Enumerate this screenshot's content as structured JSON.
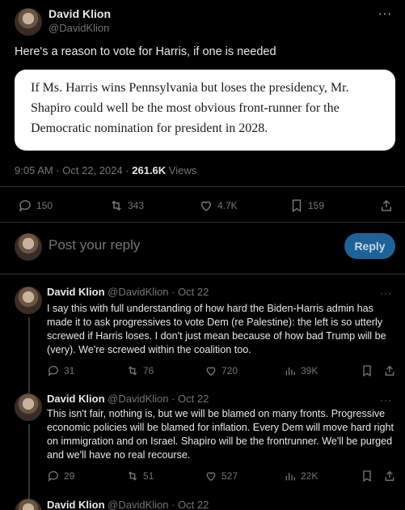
{
  "main_tweet": {
    "name": "David Klion",
    "handle": "@DavidKlion",
    "text": "Here's a reason to vote for Harris, if one is needed",
    "quote": "If Ms. Harris wins Pennsylvania but loses the presidency, Mr. Shapiro could well be the most obvious front-runner for the Democratic nomination for president in 2028.",
    "time": "9:05 AM · Oct 22, 2024 · ",
    "views_count": "261.6K",
    "views_label": " Views",
    "stats": {
      "replies": "150",
      "reposts": "343",
      "likes": "4.7K",
      "bookmarks": "159"
    }
  },
  "composer": {
    "placeholder": "Post your reply",
    "button": "Reply"
  },
  "replies": [
    {
      "name": "David Klion",
      "meta": "@DavidKlion · Oct 22",
      "text": "I say this with full understanding of how hard the Biden-Harris admin has made it to ask progressives to vote Dem (re Palestine): the left is so utterly screwed if Harris loses. I don't just mean because of how bad Trump will be (very). We're screwed within the coalition too.",
      "stats": {
        "replies": "31",
        "reposts": "76",
        "likes": "720",
        "views": "39K"
      }
    },
    {
      "name": "David Klion",
      "meta": "@DavidKlion · Oct 22",
      "text": "This isn't fair, nothing is, but we will be blamed on many fronts. Progressive economic policies will be blamed for inflation. Every Dem will move hard right on immigration and on Israel. Shapiro will be the frontrunner. We'll be purged and we'll have no real recourse.",
      "stats": {
        "replies": "29",
        "reposts": "51",
        "likes": "527",
        "views": "22K"
      }
    },
    {
      "name": "David Klion",
      "meta": "@DavidKlion · Oct 22"
    }
  ],
  "colors": {
    "background": "#000000",
    "text": "#e7e9ea",
    "muted": "#71767b",
    "divider": "#2f3336",
    "reply_button": "#1d639a"
  }
}
